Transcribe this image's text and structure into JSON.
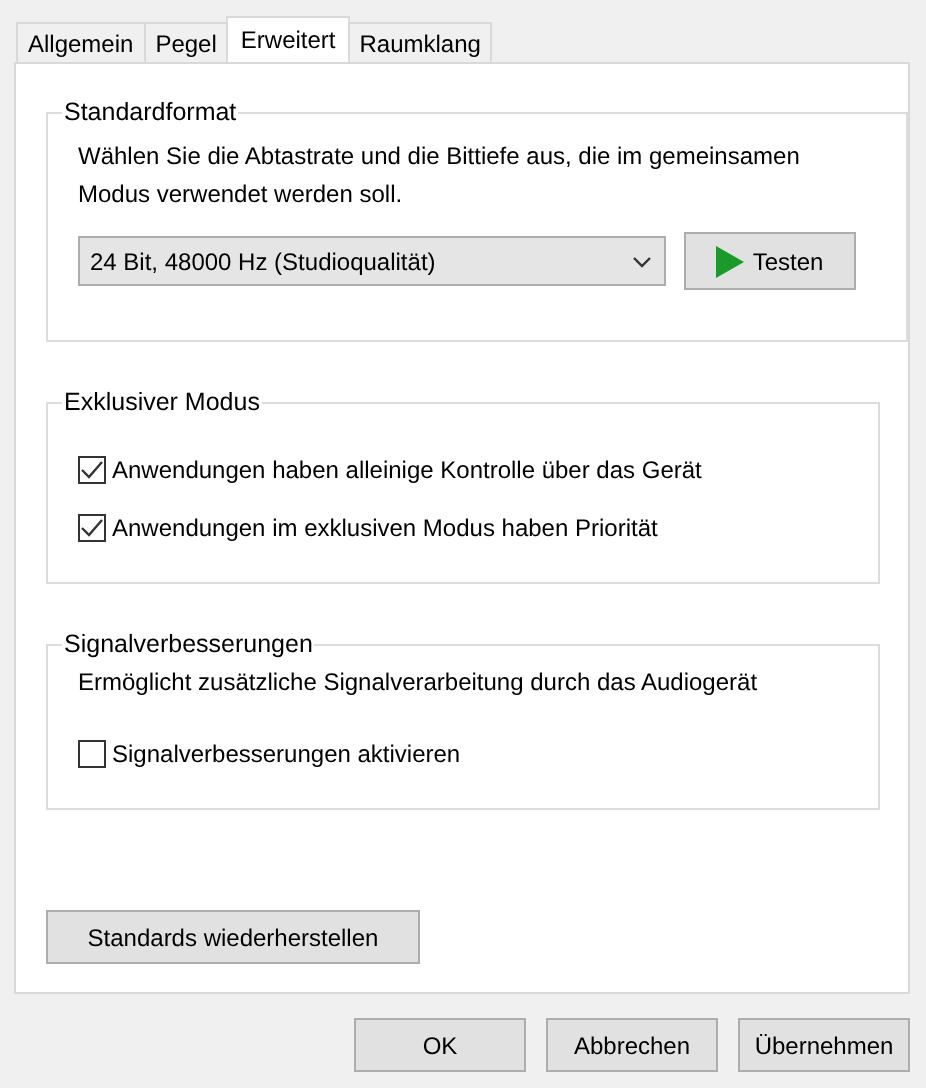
{
  "tabs": [
    {
      "label": "Allgemein",
      "selected": false
    },
    {
      "label": "Pegel",
      "selected": false
    },
    {
      "label": "Erweitert",
      "selected": true
    },
    {
      "label": "Raumklang",
      "selected": false
    }
  ],
  "standard_format": {
    "title": "Standardformat",
    "description": "Wählen Sie die Abtastrate und die Bittiefe aus, die im gemeinsamen Modus verwendet werden soll.",
    "format": "24 Bit, 48000 Hz (Studioqualität)",
    "test_button": "Testen"
  },
  "exclusive_mode": {
    "title": "Exklusiver Modus",
    "options": [
      {
        "label": "Anwendungen haben alleinige Kontrolle über das Gerät",
        "checked": true
      },
      {
        "label": "Anwendungen im exklusiven Modus haben Priorität",
        "checked": true
      }
    ]
  },
  "signal_enhancements": {
    "title": "Signalverbesserungen",
    "description": "Ermöglicht zusätzliche Signalverarbeitung durch das Audiogerät",
    "options": [
      {
        "label": "Signalverbesserungen aktivieren",
        "checked": false
      }
    ]
  },
  "restore_button": "Standards wiederherstellen",
  "buttons": [
    "OK",
    "Abbrechen",
    "Übernehmen"
  ]
}
